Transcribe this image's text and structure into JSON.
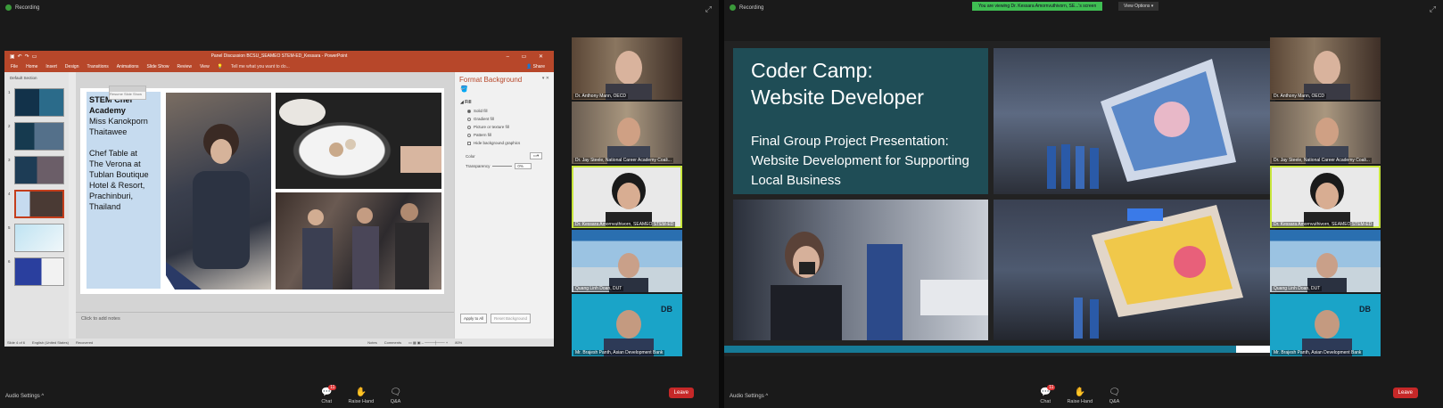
{
  "left": {
    "recording": "Recording",
    "ppt": {
      "title": "Panel Discussion BCSU_SEAMEO STEM-ED_Kessara - PowerPoint",
      "tabs": [
        "File",
        "Home",
        "Insert",
        "Design",
        "Transitions",
        "Animations",
        "Slide Show",
        "Review",
        "View"
      ],
      "tellme": "Tell me what you want to do...",
      "share": "Share",
      "section": "Default Section",
      "thumb_nums": [
        "1",
        "2",
        "3",
        "4",
        "5",
        "6"
      ],
      "slide_lines": [
        "STEM Chef",
        "Academy",
        "Miss Kanokporn",
        "Thaitawee",
        "",
        "Chef Table at",
        "The Verona at",
        "Tublan Boutique",
        "Hotel & Resort,",
        "Prachinburi,",
        "Thailand"
      ],
      "mini_label": "Resume Slide Show",
      "notes": "Click to add notes",
      "format_title": "Format Background",
      "fill_label": "Fill",
      "fill_options": [
        "Solid fill",
        "Gradient fill",
        "Picture or texture fill",
        "Pattern fill",
        "Hide background graphics"
      ],
      "color_label": "Color",
      "transparency_label": "Transparency",
      "transparency_value": "0%",
      "apply_all": "Apply to All",
      "reset_bg": "Reset Background",
      "status_slide": "Slide 4 of 6",
      "status_lang": "English (United States)",
      "status_recovered": "Recovered",
      "status_notes": "Notes",
      "status_comments": "Comments",
      "zoom": "80%"
    },
    "participants": [
      "Dr. Anthony Mann, OECD",
      "Dr. Jay Steele, National Career Academy Coali...",
      "Dr. Kessara Amornvuthivorn, SEAMEO STEM-ED",
      "Quang Linh Doan, DUT",
      "Mr. Brajesh Panth, Asian Development Bank"
    ],
    "toolbar": {
      "audio": "Audio Settings",
      "chat": "Chat",
      "chat_badge": "11",
      "raise": "Raise Hand",
      "qa": "Q&A",
      "leave": "Leave"
    }
  },
  "right": {
    "recording": "Recording",
    "banner": "You are viewing Dr. Kessara Amornvuthivorn, SE...'s screen",
    "view_options": "View Options",
    "slide": {
      "title1": "Coder Camp:",
      "title2": "Website Developer",
      "sub1": "Final Group Project Presentation:",
      "sub2": "Website Development for Supporting",
      "sub3": "Local Business"
    },
    "participants": [
      "Dr. Anthony Mann, OECD",
      "Dr. Jay Steele, National Career Academy Coali...",
      "Dr. Kessara Amornvuthivorn, SEAMEO STEM-ED",
      "Quang Linh Doan, DUT",
      "Mr. Brajesh Panth, Asian Development Bank"
    ],
    "toolbar": {
      "audio": "Audio Settings",
      "chat": "Chat",
      "chat_badge": "11",
      "raise": "Raise Hand",
      "qa": "Q&A",
      "leave": "Leave"
    }
  }
}
